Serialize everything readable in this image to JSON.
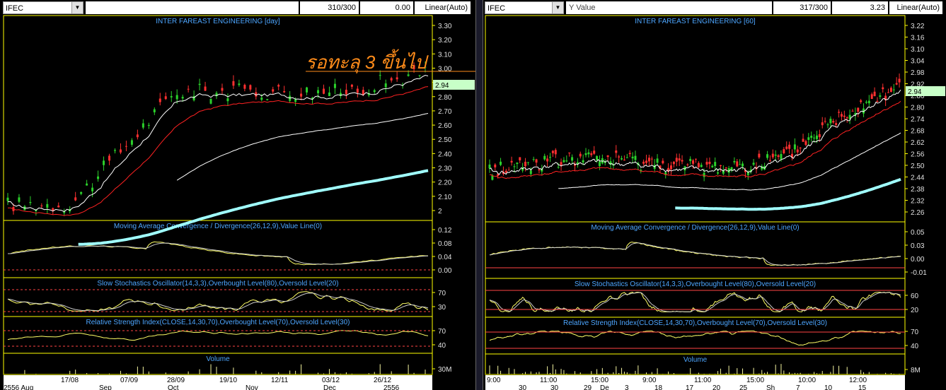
{
  "colors": {
    "bg": "#000000",
    "axis": "#ffff00",
    "title": "#4da6ff",
    "grid": "#ff4444",
    "price_tag": "#c8ffc8",
    "ema_short": "#ffffff",
    "ema_mid": "#ff2222",
    "ema_long": "#ffffff",
    "trend": "#a0ffff",
    "macd": "#ffff00",
    "annotation": "#ff8c1a"
  },
  "left": {
    "symbol": "IFEC",
    "bars": "310/300",
    "value": "0.00",
    "scale": "Linear(Auto)",
    "price_title": "INTER FAREAST ENGINEERING [day]",
    "annotation": "รอทะลุ 3 ขึ้นไป",
    "price_tag": "2.94",
    "price_ticks": [
      "3.30",
      "3.20",
      "3.10",
      "3.00",
      "2.90",
      "2.80",
      "2.70",
      "2.60",
      "2.50",
      "2.40",
      "2.30",
      "2.20",
      "2.10",
      "2"
    ],
    "macd_title": "Moving Average Convergence / Divergence(26,12,9),Value Line(0)",
    "macd_ticks": [
      "0.12",
      "0.08",
      "0.04",
      "0.00"
    ],
    "stoch_title": "Slow Stochastics Oscillator(14,3,3),Overbought Level(80),Oversold Level(20)",
    "stoch_ticks": [
      "70",
      "30"
    ],
    "rsi_title": "Relative Strength Index(CLOSE,14,30,70),Overbought Level(70),Oversold Level(30)",
    "rsi_ticks": [
      "70",
      "40"
    ],
    "volume_title": "Volume",
    "volume_ticks": [
      "30M"
    ],
    "date_ticks": [
      "17/08",
      "07/09",
      "28/09",
      "19/10",
      "12/11",
      "03/12",
      "26/12"
    ],
    "month_ticks": [
      "2556 Aug",
      "Sep",
      "Oct",
      "Nov",
      "Dec",
      "2556"
    ]
  },
  "right": {
    "symbol": "IFEC",
    "y_label": "Y Value",
    "bars": "317/300",
    "value": "3.23",
    "scale": "Linear(Auto)",
    "price_title": "INTER FAREAST ENGINEERING [60]",
    "price_tag": "2.94",
    "price_ticks": [
      "3.22",
      "3.16",
      "3.10",
      "3.04",
      "2.98",
      "2.92",
      "2.86",
      "2.80",
      "2.74",
      "2.68",
      "2.62",
      "2.56",
      "2.50",
      "2.44",
      "2.38",
      "2.32",
      "2.26"
    ],
    "macd_title": "Moving Average Convergence / Divergence(26,12,9),Value Line(0)",
    "macd_ticks": [
      "0.05",
      "0.03",
      "0.00",
      "-0.01"
    ],
    "stoch_title": "Slow Stochastics Oscillator(14,3,3),Overbought Level(80),Oversold Level(20)",
    "stoch_ticks": [
      "60",
      "20"
    ],
    "rsi_title": "Relative Strength Index(CLOSE,14,30,70),Overbought Level(70),Oversold Level(30)",
    "rsi_ticks": [
      "70",
      "40"
    ],
    "volume_title": "Volume",
    "volume_ticks": [
      "8M"
    ],
    "time_ticks": [
      "9:00",
      "11:00",
      "15:00",
      "9:00",
      "11:00",
      "15:00",
      "10:00",
      "12:00"
    ],
    "day_ticks": [
      "30",
      "30",
      "29",
      "De",
      "3",
      "18",
      "17",
      "20",
      "25",
      "Sh",
      "7",
      "10",
      "15"
    ]
  }
}
